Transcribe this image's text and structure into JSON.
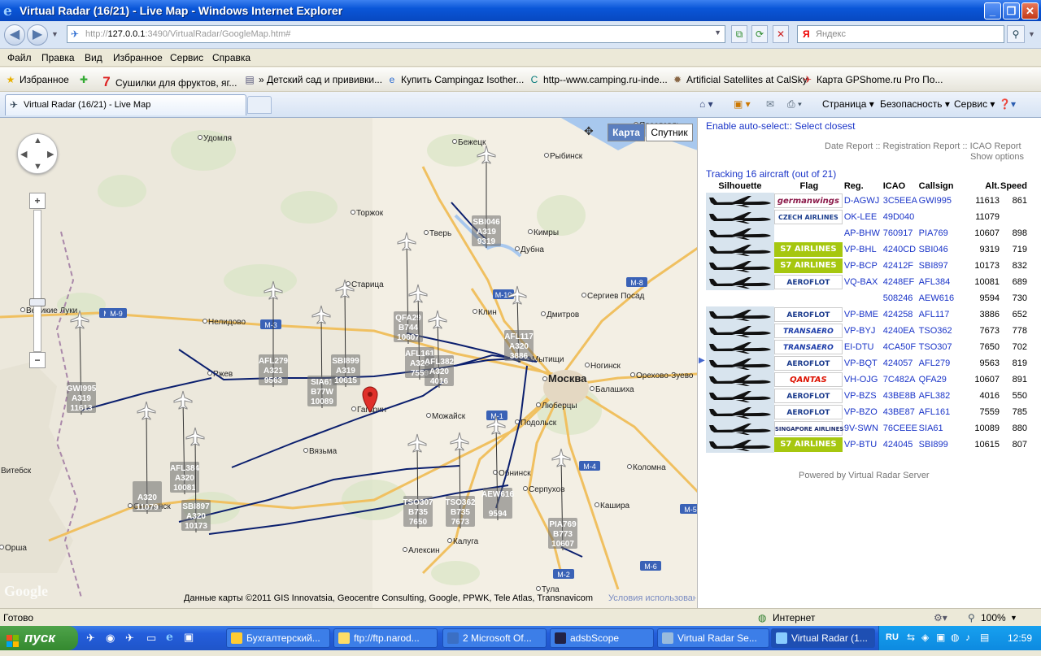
{
  "window": {
    "title": "Virtual Radar (16/21) - Live Map - Windows Internet Explorer"
  },
  "address": {
    "url_prefix": "http://",
    "url_host": "127.0.0.1",
    "url_rest": ":3490/VirtualRadar/GoogleMap.htm#",
    "search_placeholder": "Яндекс"
  },
  "menu": [
    "Файл",
    "Правка",
    "Вид",
    "Избранное",
    "Сервис",
    "Справка"
  ],
  "favorites": {
    "label": "Избранное",
    "items": [
      "Сушилки для фруктов, яг...",
      "» Детский сад и прививки...",
      "Купить Campingaz Isother...",
      "http--www.camping.ru-inde...",
      "Artificial Satellites at CalSky",
      "Карта  GPShome.ru Pro  По..."
    ]
  },
  "tab": {
    "label": "Virtual Radar (16/21) - Live Map"
  },
  "commands": [
    "Страница ▾",
    "Безопасность ▾",
    "Сервис ▾"
  ],
  "map": {
    "type_map": "Карта",
    "type_satellite": "Спутник",
    "copyright": "Данные карты ©2011 GIS Innovatsia, Geocentre Consulting, Google, PPWK, Tele Atlas, Transnavicom",
    "terms": "Условия использования",
    "cities": [
      {
        "name": "Тверь"
      },
      {
        "name": "Москва"
      },
      {
        "name": "Мытищи"
      },
      {
        "name": "Клин"
      },
      {
        "name": "Дмитров"
      },
      {
        "name": "Сергиев Посад"
      },
      {
        "name": "Смоленск"
      },
      {
        "name": "Вязьма"
      },
      {
        "name": "Калуга"
      },
      {
        "name": "Тула"
      },
      {
        "name": "Серпухов"
      },
      {
        "name": "Обнинск"
      },
      {
        "name": "Подольск"
      },
      {
        "name": "Ногинск"
      },
      {
        "name": "Коломна"
      },
      {
        "name": "Ржев"
      },
      {
        "name": "Великие Луки"
      },
      {
        "name": "Торжок"
      },
      {
        "name": "Кимры"
      },
      {
        "name": "Дубна"
      },
      {
        "name": "Можайск"
      },
      {
        "name": "Гагарин"
      },
      {
        "name": "Орша"
      },
      {
        "name": "Витебск"
      },
      {
        "name": "Ярославль"
      },
      {
        "name": "Бежецк"
      },
      {
        "name": "Рыбинск"
      },
      {
        "name": "Удомля"
      },
      {
        "name": "Нелидово"
      },
      {
        "name": "Старица"
      },
      {
        "name": "Балашиха"
      },
      {
        "name": "Люберцы"
      },
      {
        "name": "Орехово-Зуево"
      },
      {
        "name": "Кашира"
      },
      {
        "name": "Алексин"
      }
    ],
    "road_labels": [
      "M-9",
      "M-10",
      "M-8",
      "M-1",
      "M-4",
      "M-2",
      "M-3",
      "M-5",
      "M-6",
      "M-9"
    ],
    "aircraft": [
      {
        "label1": "SBI046",
        "label2": "A319",
        "label3": "9319"
      },
      {
        "label1": "GWI995",
        "label2": "A319",
        "label3": "11613"
      },
      {
        "label1": "AFL279",
        "label2": "A321",
        "label3": "9563"
      },
      {
        "label1": "SIA61",
        "label2": "B77W",
        "label3": "10089"
      },
      {
        "label1": "SBI899",
        "label2": "A319",
        "label3": "10615"
      },
      {
        "label1": "QFA29",
        "label2": "B744",
        "label3": "10607"
      },
      {
        "label1": "AFL161",
        "label2": "A320",
        "label3": "7559"
      },
      {
        "label1": "AFL382",
        "label2": "A320",
        "label3": "4016"
      },
      {
        "label1": "AFL117",
        "label2": "A320",
        "label3": "3886"
      },
      {
        "label1": "",
        "label2": "A320",
        "label3": "11079"
      },
      {
        "label1": "AFL384",
        "label2": "A320",
        "label3": "10081"
      },
      {
        "label1": "SBI897",
        "label2": "A320",
        "label3": "10173"
      },
      {
        "label1": "TSO307",
        "label2": "B735",
        "label3": "7650"
      },
      {
        "label1": "TSO362",
        "label2": "B735",
        "label3": "7673"
      },
      {
        "label1": "AEW616",
        "label2": "",
        "label3": "9594"
      },
      {
        "label1": "PIA769",
        "label2": "B773",
        "label3": "10607"
      }
    ]
  },
  "panel": {
    "enable_autoselect": "Enable auto-select",
    "sep1": "::",
    "select_closest": "Select closest",
    "date_report": "Date Report",
    "registration_report": "Registration Report",
    "icao_report": "ICAO Report",
    "sep2": "::",
    "show_options": "Show options",
    "tracking": "Tracking 16 aircraft (out of 21)",
    "columns": [
      "Silhouette",
      "Flag",
      "Reg.",
      "ICAO",
      "Callsign",
      "Alt.",
      "Speed"
    ],
    "rows": [
      {
        "sil": true,
        "flag": "germanwings",
        "reg": "D-AGWJ",
        "icao": "3C5EEA",
        "cs": "GWI995",
        "alt": "11613",
        "spd": "861"
      },
      {
        "sil": true,
        "flag": "CZECH AIRLINES",
        "reg": "OK-LEE",
        "icao": "49D040",
        "cs": "",
        "alt": "11079",
        "spd": ""
      },
      {
        "sil": true,
        "flag": "",
        "reg": "AP-BHW",
        "icao": "760917",
        "cs": "PIA769",
        "alt": "10607",
        "spd": "898"
      },
      {
        "sil": true,
        "flag": "S7 AIRLINES",
        "reg": "VP-BHL",
        "icao": "4240CD",
        "cs": "SBI046",
        "alt": "9319",
        "spd": "719"
      },
      {
        "sil": true,
        "flag": "S7 AIRLINES",
        "reg": "VP-BCP",
        "icao": "42412F",
        "cs": "SBI897",
        "alt": "10173",
        "spd": "832"
      },
      {
        "sil": true,
        "flag": "AEROFLOT",
        "reg": "VQ-BAX",
        "icao": "4248EF",
        "cs": "AFL384",
        "alt": "10081",
        "spd": "689"
      },
      {
        "sil": false,
        "flag": "",
        "reg": "",
        "icao": "508246",
        "cs": "AEW616",
        "alt": "9594",
        "spd": "730"
      },
      {
        "sil": true,
        "flag": "AEROFLOT",
        "reg": "VP-BME",
        "icao": "424258",
        "cs": "AFL117",
        "alt": "3886",
        "spd": "652"
      },
      {
        "sil": true,
        "flag": "TRANSAERO",
        "reg": "VP-BYJ",
        "icao": "4240EA",
        "cs": "TSO362",
        "alt": "7673",
        "spd": "778"
      },
      {
        "sil": true,
        "flag": "TRANSAERO",
        "reg": "EI-DTU",
        "icao": "4CA50F",
        "cs": "TSO307",
        "alt": "7650",
        "spd": "702"
      },
      {
        "sil": true,
        "flag": "AEROFLOT",
        "reg": "VP-BQT",
        "icao": "424057",
        "cs": "AFL279",
        "alt": "9563",
        "spd": "819"
      },
      {
        "sil": true,
        "flag": "QANTAS",
        "reg": "VH-OJG",
        "icao": "7C482A",
        "cs": "QFA29",
        "alt": "10607",
        "spd": "891"
      },
      {
        "sil": true,
        "flag": "AEROFLOT",
        "reg": "VP-BZS",
        "icao": "43BE8B",
        "cs": "AFL382",
        "alt": "4016",
        "spd": "550"
      },
      {
        "sil": true,
        "flag": "AEROFLOT",
        "reg": "VP-BZO",
        "icao": "43BE87",
        "cs": "AFL161",
        "alt": "7559",
        "spd": "785"
      },
      {
        "sil": true,
        "flag": "SINGAPORE AIRLINES",
        "reg": "9V-SWN",
        "icao": "76CEEE",
        "cs": "SIA61",
        "alt": "10089",
        "spd": "880"
      },
      {
        "sil": true,
        "flag": "S7 AIRLINES",
        "reg": "VP-BTU",
        "icao": "424045",
        "cs": "SBI899",
        "alt": "10615",
        "spd": "807"
      }
    ],
    "powered": "Powered by Virtual Radar Server"
  },
  "status": {
    "left": "Готово",
    "zone": "Интернет",
    "zoom": "100%"
  },
  "taskbar": {
    "start": "пуск",
    "tasks": [
      "Бухгалтерский...",
      "ftp://ftp.narod...",
      "2 Microsoft Of...",
      "adsbScope",
      "Virtual Radar Se...",
      "Virtual Radar (1..."
    ],
    "lang": "RU",
    "clock": "12:59"
  },
  "colors": {
    "accent": "#1a34c8",
    "s7": "#a6c70f",
    "aeroflot": "#c4161c",
    "track": "#0b1f6e"
  }
}
